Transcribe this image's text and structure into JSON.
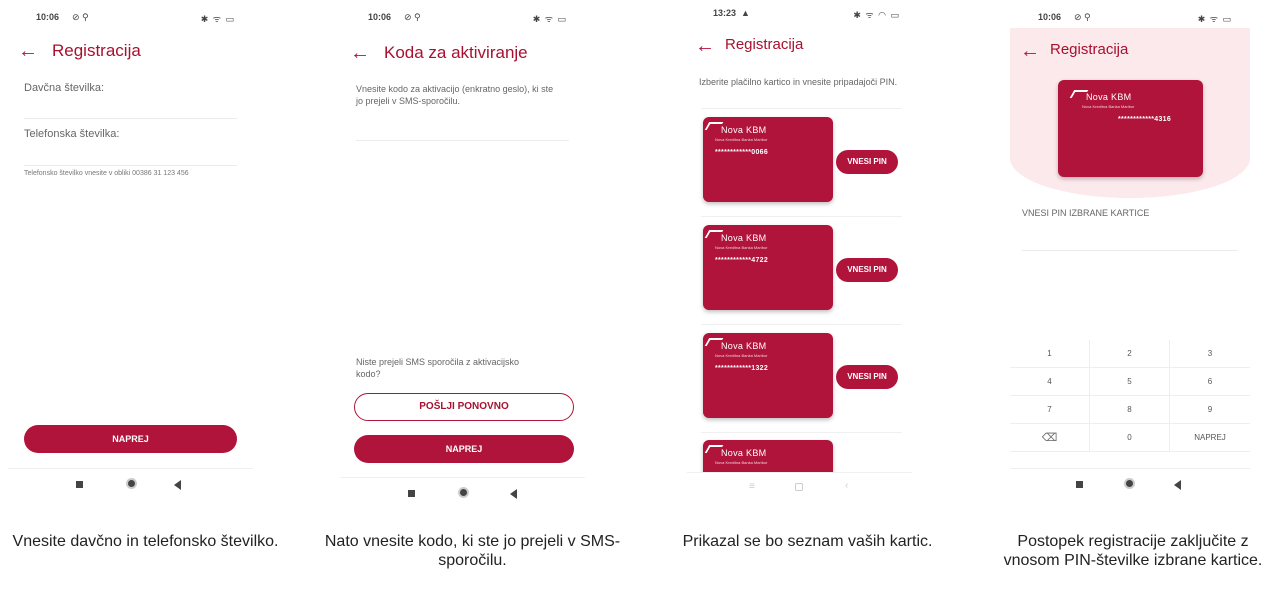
{
  "screens": [
    {
      "status": {
        "time": "10:06",
        "sys": "⊘ ⚲",
        "right": "✱ ᯤ ▭"
      },
      "title": "Registracija",
      "fields": [
        {
          "label": "Davčna številka:"
        },
        {
          "label": "Telefonska številka:"
        }
      ],
      "hint": "Telefonsko številko vnesite v obliki 00386 31 123 456",
      "next_label": "NAPREJ",
      "caption": "Vnesite davčno in telefonsko številko."
    },
    {
      "status": {
        "time": "10:06",
        "sys": "⊘ ⚲",
        "right": "✱ ᯤ ▭"
      },
      "title": "Koda za aktiviranje",
      "instruction": "Vnesite kodo za aktivacijo (enkratno geslo), ki ste jo prejeli v SMS-sporočilu.",
      "no_sms_text": "Niste prejeli SMS sporočila z aktivacijsko kodo?",
      "resend_label": "POŠLJI PONOVNO",
      "next_label": "NAPREJ",
      "caption": "Nato vnesite kodo, ki ste jo prejeli v SMS-sporočilu."
    },
    {
      "status": {
        "time": "13:23",
        "sys": "▲",
        "right": "✱ ᯤ ◠ ▭"
      },
      "title": "Registracija",
      "instruction": "Izberite plačilno kartico in vnesite pripadajoči PIN.",
      "cards": [
        {
          "brand": "Nova KBM",
          "sub": "Nova Kreditna Banka Maribor",
          "number": "************0066",
          "button": "VNESI PIN"
        },
        {
          "brand": "Nova KBM",
          "sub": "Nova Kreditna Banka Maribor",
          "number": "************4722",
          "button": "VNESI PIN"
        },
        {
          "brand": "Nova KBM",
          "sub": "Nova Kreditna Banka Maribor",
          "number": "************1322",
          "button": "VNESI PIN"
        },
        {
          "brand": "Nova KBM",
          "sub": "Nova Kreditna Banka Maribor"
        }
      ],
      "caption": "Prikazal se bo seznam vaših kartic."
    },
    {
      "status": {
        "time": "10:06",
        "sys": "⊘ ⚲",
        "right": "✱ ᯤ ▭"
      },
      "title": "Registracija",
      "card": {
        "brand": "Nova KBM",
        "sub": "Nova Kreditna Banka Maribor",
        "number": "************4316"
      },
      "pin_label": "VNESI PIN IZBRANE KARTICE",
      "keys": [
        "1",
        "2",
        "3",
        "4",
        "5",
        "6",
        "7",
        "8",
        "9",
        "0",
        "NAPREJ"
      ],
      "caption": "Postopek registracije zaključite z vnosom PIN-številke izbrane kartice."
    }
  ],
  "colors": {
    "accent": "#b0143b",
    "title": "#a8102f",
    "pink_bg": "#fbe9ec"
  }
}
